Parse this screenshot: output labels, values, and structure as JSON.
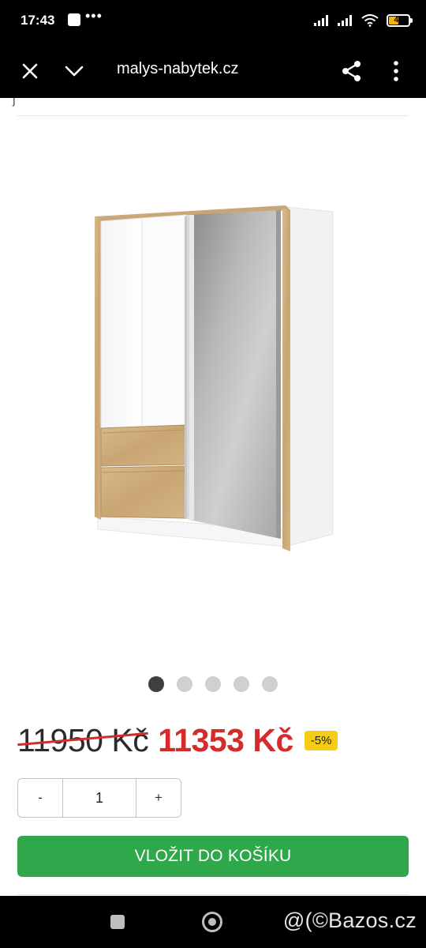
{
  "status_bar": {
    "time": "17:43",
    "dots": "•••",
    "battery": "48",
    "battery_level": 0.48,
    "battery_color": "#f7b500"
  },
  "browser": {
    "url": "malys-nabytek.cz",
    "icons": [
      "close-icon",
      "chevron-down-icon",
      "share-icon",
      "more-vert-icon"
    ]
  },
  "page": {
    "top_fragment": "j",
    "carousel": {
      "count": 5,
      "active_index": 0
    },
    "price": {
      "old": "11950 Kč",
      "new": "11353 Kč",
      "discount": "-5%"
    },
    "colors": {
      "price_red": "#d42b2b",
      "cart_green": "#2ea84a",
      "badge_yellow": "#f7cc16"
    },
    "quantity": {
      "minus": "-",
      "value": "1",
      "plus": "+"
    },
    "cart_button": "VLOŽIT DO KOŠÍKU"
  },
  "nav": {
    "watermark": "@(©Bazos.cz"
  }
}
